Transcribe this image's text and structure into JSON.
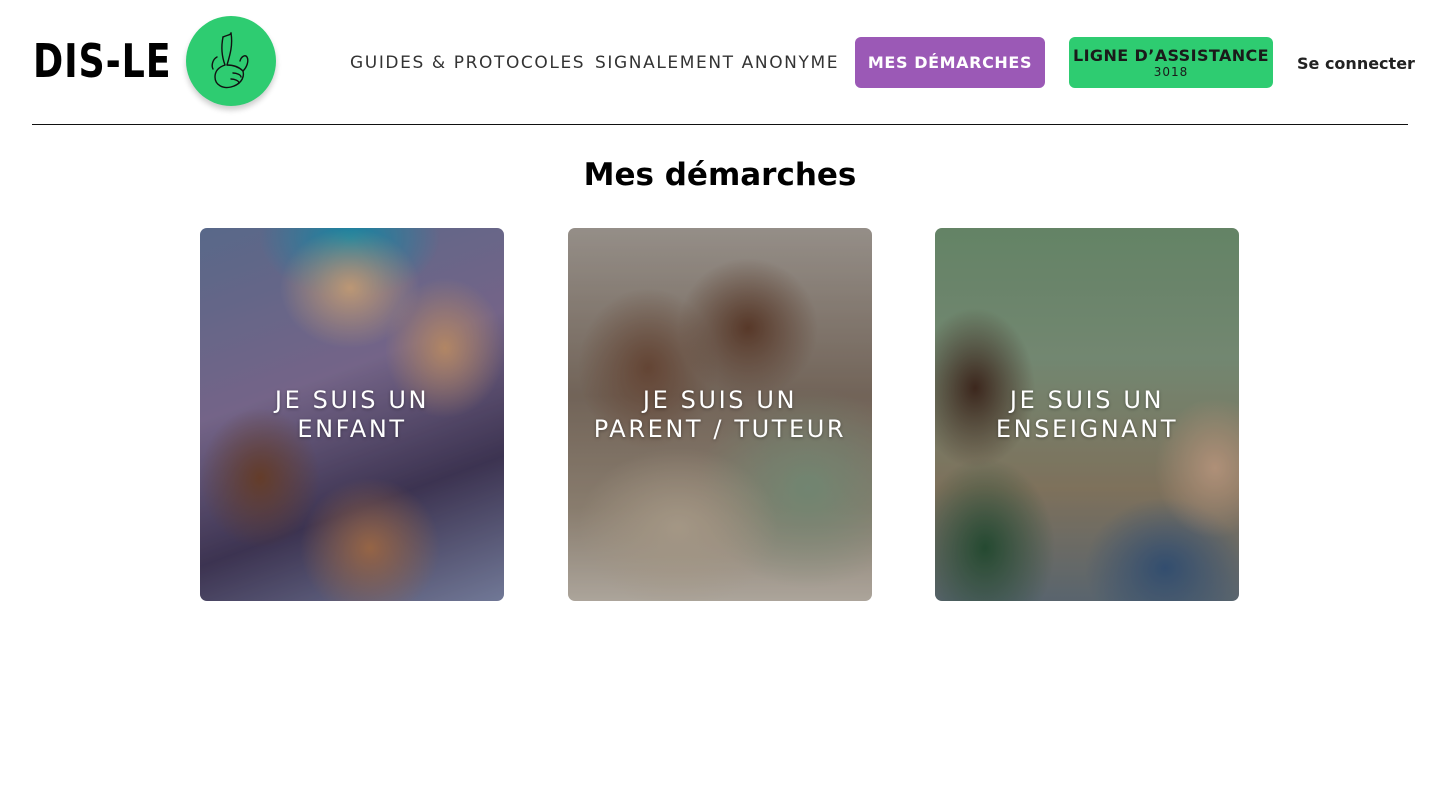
{
  "header": {
    "logo_text": "DIS-LE",
    "nav": {
      "guides": "GUIDES & PROTOCOLES",
      "signalement": "SIGNALEMENT ANONYME",
      "demarches": "MES DÉMARCHES",
      "assistance_label": "LIGNE D’ASSISTANCE",
      "assistance_number": "3018",
      "login": "Se connecter"
    }
  },
  "main": {
    "title": "Mes démarches",
    "cards": [
      {
        "label": "JE SUIS UN\nENFANT"
      },
      {
        "label": "JE SUIS UN\nPARENT / TUTEUR"
      },
      {
        "label": "JE SUIS UN\nENSEIGNANT"
      }
    ]
  },
  "colors": {
    "accent_purple": "#9b59b6",
    "accent_green": "#2ecc71",
    "divider": "#111111"
  },
  "icons": {
    "logo_mark": "crossed-fingers-icon"
  }
}
